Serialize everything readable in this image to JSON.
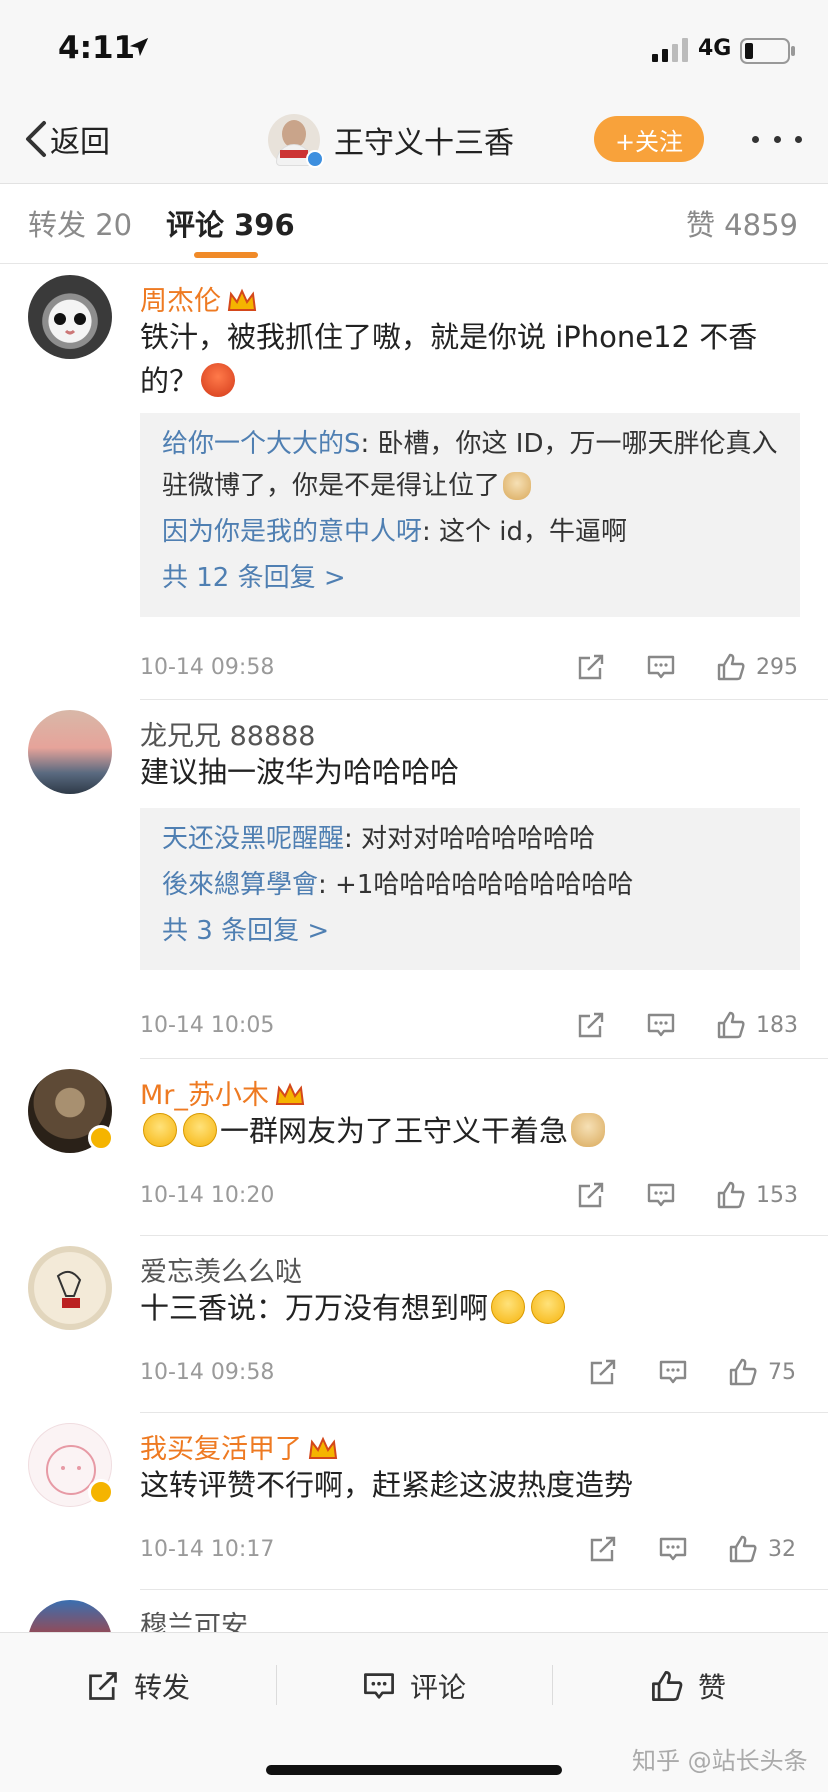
{
  "status_bar": {
    "time": "4:11",
    "carrier": "4G"
  },
  "nav": {
    "back_label": "返回",
    "poster_name": "王守义十三香",
    "follow_label": "+关注"
  },
  "tabs": {
    "repost": "转发 20",
    "comment": "评论 396",
    "like": "赞 4859",
    "accent": "#f08a28"
  },
  "comments": [
    {
      "name": "周杰伦",
      "vip": true,
      "text": "铁汁，被我抓住了嗷，就是你说 iPhone12 不香的？",
      "replies": [
        {
          "name": "给你一个大大的S",
          "text": ": 卧槽，你这 ID，万一哪天胖伦真入驻微博了，你是不是得让位了"
        },
        {
          "name": "因为你是我的意中人呀",
          "text": ": 这个 id，牛逼啊"
        }
      ],
      "more": "共 12 条回复 >",
      "time": "10-14 09:58",
      "likes": "295"
    },
    {
      "name": "龙兄兄 88888",
      "vip": false,
      "text": "建议抽一波华为哈哈哈哈",
      "replies": [
        {
          "name": "天还没黑呢醒醒",
          "text": ": 对对对哈哈哈哈哈哈"
        },
        {
          "name": "後來總算學會",
          "text": ": +1哈哈哈哈哈哈哈哈哈哈"
        }
      ],
      "more": "共 3 条回复 >",
      "time": "10-14 10:05",
      "likes": "183"
    },
    {
      "name": "Mr_苏小木",
      "vip": true,
      "text": "一群网友为了王守义干着急",
      "time": "10-14 10:20",
      "likes": "153"
    },
    {
      "name": "爱忘羡么么哒",
      "vip": false,
      "text": "十三香说：万万没有想到啊",
      "time": "10-14 09:58",
      "likes": "75"
    },
    {
      "name": "我买复活甲了",
      "vip": true,
      "text": "这转评赞不行啊，赶紧趁这波热度造势",
      "time": "10-14 10:17",
      "likes": "32"
    },
    {
      "name": "穆兰可安",
      "vip": false
    }
  ],
  "bottom": {
    "repost": "转发",
    "comment": "评论",
    "like": "赞",
    "watermark": "知乎 @站长头条"
  }
}
